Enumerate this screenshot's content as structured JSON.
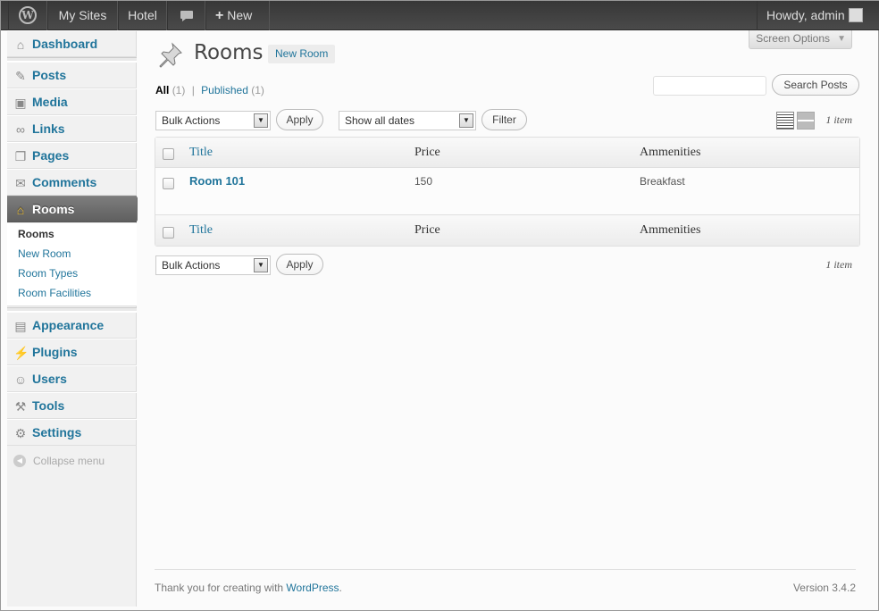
{
  "admin_bar": {
    "mysites": "My Sites",
    "site_name": "Hotel",
    "new_label": "New",
    "howdy": "Howdy, admin"
  },
  "sidebar": {
    "items": [
      {
        "label": "Dashboard",
        "icon": "home-icon"
      },
      {
        "label": "Posts",
        "icon": "pushpin-icon"
      },
      {
        "label": "Media",
        "icon": "media-icon"
      },
      {
        "label": "Links",
        "icon": "link-icon"
      },
      {
        "label": "Pages",
        "icon": "pages-icon"
      },
      {
        "label": "Comments",
        "icon": "comment-icon"
      },
      {
        "label": "Rooms",
        "icon": "house-icon"
      },
      {
        "label": "Appearance",
        "icon": "appearance-icon"
      },
      {
        "label": "Plugins",
        "icon": "plug-icon"
      },
      {
        "label": "Users",
        "icon": "users-icon"
      },
      {
        "label": "Tools",
        "icon": "tools-icon"
      },
      {
        "label": "Settings",
        "icon": "settings-icon"
      }
    ],
    "submenu": [
      "Rooms",
      "New Room",
      "Room Types",
      "Room Facilities"
    ],
    "collapse": "Collapse menu"
  },
  "screen_options": "Screen Options",
  "page": {
    "title": "Rooms",
    "add_new": "New Room"
  },
  "views": {
    "all": "All",
    "all_count": "(1)",
    "separator": "|",
    "published": "Published",
    "published_count": "(1)"
  },
  "search": {
    "value": "",
    "button": "Search Posts"
  },
  "tablenav": {
    "bulk_actions": "Bulk Actions",
    "apply": "Apply",
    "dates": "Show all dates",
    "filter": "Filter",
    "displaying": "1 item"
  },
  "table": {
    "columns": [
      "Title",
      "Price",
      "Ammenities"
    ],
    "rows": [
      {
        "title": "Room 101",
        "price": "150",
        "ammenities": "Breakfast"
      }
    ]
  },
  "footer": {
    "thanks": "Thank you for creating with ",
    "wp_link": "WordPress",
    "period": ".",
    "version": "Version 3.4.2"
  },
  "colors": {
    "accent": "#21759b",
    "adminbar": "#464646",
    "current_menu": "#6b6b6b"
  }
}
